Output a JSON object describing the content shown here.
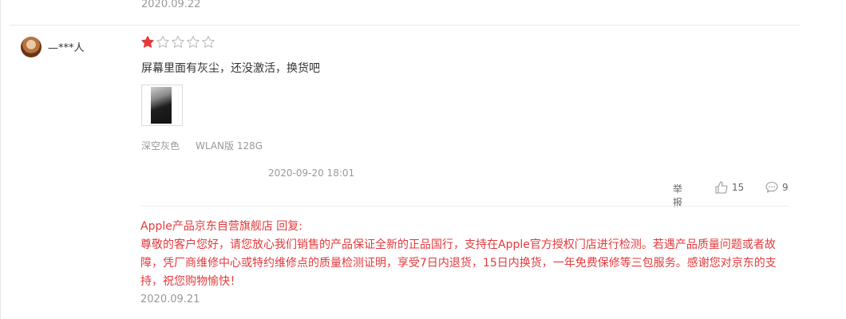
{
  "previous_review": {
    "date": "2020.09.22"
  },
  "review": {
    "username": "—***人",
    "rating": 1,
    "max_rating": 5,
    "comment": "屏幕里面有灰尘，还没激活，换货吧",
    "spec_color": "深空灰色",
    "spec_version": "WLAN版 128G",
    "post_time": "2020-09-20 18:01",
    "actions": {
      "report_label": "举报",
      "like_count": "15",
      "reply_count": "9"
    }
  },
  "seller_reply": {
    "header": "Apple产品京东自营旗舰店 回复:",
    "text": "尊敬的客户您好，请您放心我们销售的产品保证全新的正品国行，支持在Apple官方授权门店进行检测。若遇产品质量问题或者故障，凭厂商维修中心或特约维修点的质量检测证明，享受7日内退货，15日内换货，一年免费保修等三包服务。感谢您对京东的支持，祝您购物愉快！",
    "date": "2020.09.21"
  },
  "colors": {
    "reply_red": "#e4393c",
    "star_red": "#e4393c",
    "muted": "#999999"
  },
  "icons": [
    "star-filled-icon",
    "star-empty-icon",
    "thumbs-up-icon",
    "comment-bubble-icon"
  ]
}
